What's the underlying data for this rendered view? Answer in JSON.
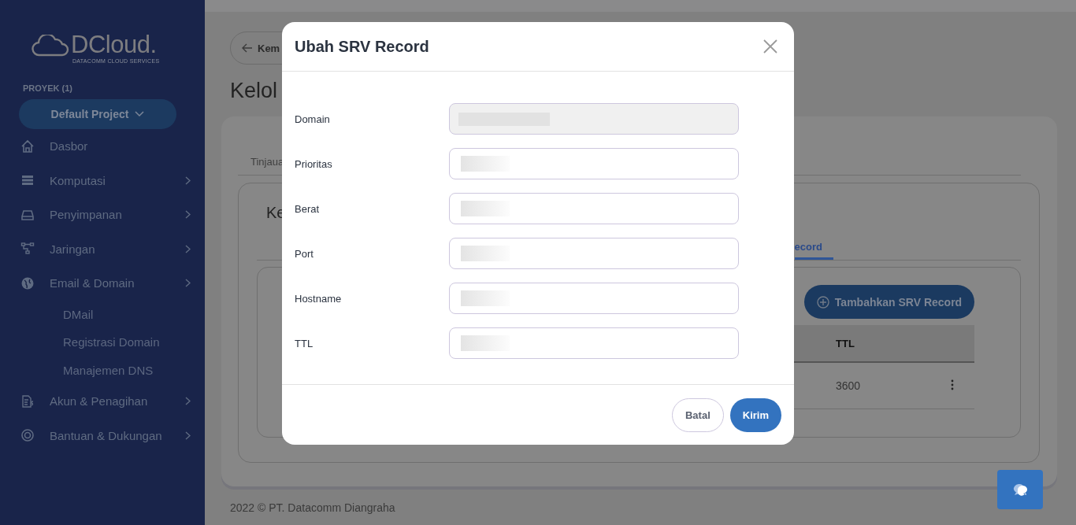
{
  "sidebar": {
    "logo": {
      "name": "DCloud.",
      "tagline": "DATACOMM CLOUD SERVICES"
    },
    "project_label": "PROYEK (1)",
    "project_button": "Default Project",
    "items": [
      {
        "label": "Dasbor",
        "chevron": false
      },
      {
        "label": "Komputasi",
        "chevron": true
      },
      {
        "label": "Penyimpanan",
        "chevron": true
      },
      {
        "label": "Jaringan",
        "chevron": true
      },
      {
        "label": "Email & Domain",
        "chevron": true,
        "children": [
          {
            "label": "DMail"
          },
          {
            "label": "Registrasi Domain"
          },
          {
            "label": "Manajemen DNS"
          }
        ]
      },
      {
        "label": "Akun & Penagihan",
        "chevron": true
      },
      {
        "label": "Bantuan & Dukungan",
        "chevron": true
      }
    ]
  },
  "back_button": "Kem",
  "page_title": "Kelol",
  "tabs": [
    {
      "label": "Tinjaua",
      "selected": false
    }
  ],
  "card_title": "Ke",
  "subtabs": [
    {
      "label": "ecord",
      "selected": true
    }
  ],
  "add_button": "Tambahkan SRV Record",
  "table": {
    "columns": [
      "TTL"
    ],
    "rows": [
      [
        "3600"
      ]
    ]
  },
  "footer": "2022 © PT. Datacomm Diangraha",
  "modal": {
    "title": "Ubah SRV Record",
    "fields": [
      {
        "label": "Domain",
        "disabled": true,
        "value_blurred": true
      },
      {
        "label": "Prioritas",
        "disabled": false,
        "value_blurred": true
      },
      {
        "label": "Berat",
        "disabled": false,
        "value_blurred": true
      },
      {
        "label": "Port",
        "disabled": false,
        "value_blurred": true
      },
      {
        "label": "Hostname",
        "disabled": false,
        "value_blurred": true
      },
      {
        "label": "TTL",
        "disabled": false,
        "value_blurred": true
      }
    ],
    "buttons": [
      {
        "label": "Batal",
        "kind": "secondary"
      },
      {
        "label": "Kirim",
        "kind": "primary"
      }
    ]
  }
}
